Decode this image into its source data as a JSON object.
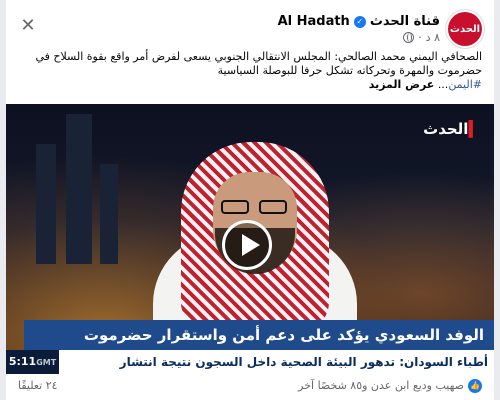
{
  "post": {
    "page_name": "قناة الحدث",
    "page_name_latin": "Al Hadath",
    "time": "٨ د",
    "avatar_text": "الحدث",
    "text_line1": "الصحافي اليمني محمد الصالحي: المجلس الانتقالي الجنوبي يسعى لفرض أمر واقع بقوة السلاح في",
    "text_line2": "حضرموت والمهرة وتحركاته تشكل حرفا للبوصلة السياسية",
    "hashtag": "#اليمن",
    "ellipsis": "...",
    "see_more": "عرض المزيد"
  },
  "video": {
    "logo_main": "الحدث",
    "headline": "الوفد السعودي يؤكد على دعم أمن واستقرار حضرموت",
    "ticker": "أطباء السودان: تدهور البيئة الصحية داخل السجون نتيجة انتشار",
    "clock_time": "5:11",
    "clock_zone": "GMT"
  },
  "footer": {
    "reactions_text": "صهيب وديع ابن عدن و٨٥ شخصًا آخر",
    "comments_text": "٢٤ تعليقًا"
  },
  "colors": {
    "brand_red": "#c8102e",
    "headline_blue": "#1f4a8c",
    "verified_blue": "#1877f2"
  }
}
